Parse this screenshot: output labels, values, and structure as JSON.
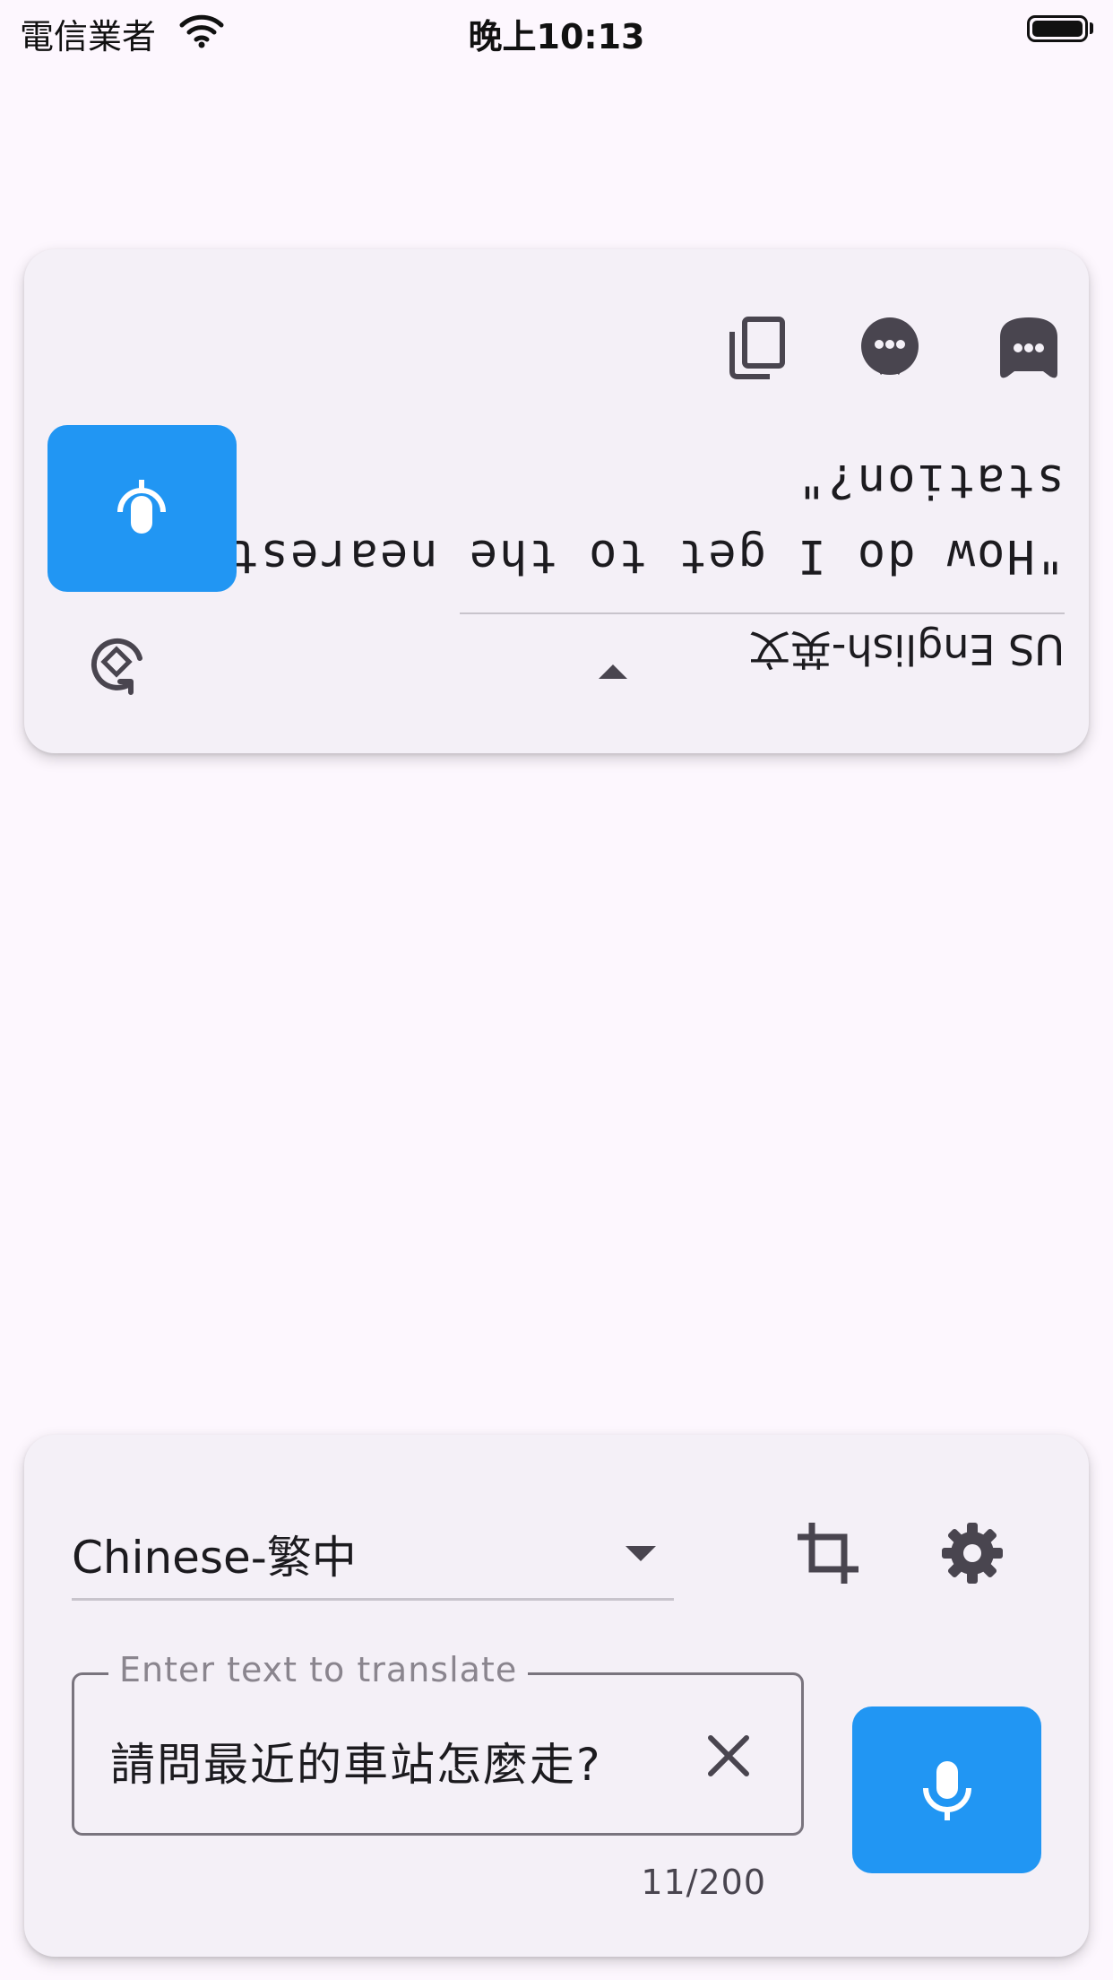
{
  "status_bar": {
    "carrier": "電信業者",
    "time": "晚上10:13"
  },
  "top_panel": {
    "target_language": "US English-英文",
    "translated_text": "\"How do I get to the nearest station?\"",
    "icons": {
      "rotate": "rotate-icon",
      "speaker": "speaker-icon",
      "copy": "copy-icon",
      "face_round": "face-round-icon",
      "face_rounded_square": "face-rounded-square-icon"
    }
  },
  "bottom_panel": {
    "source_language": "Chinese-繁中",
    "input": {
      "label": "Enter text to translate",
      "value": "請問最近的車站怎麼走?",
      "char_count": "11/200"
    },
    "icons": {
      "crop": "crop-icon",
      "settings": "gear-icon",
      "clear": "close-icon",
      "mic": "microphone-icon"
    }
  },
  "colors": {
    "accent": "#2196f3",
    "background": "#fdf7fe",
    "card": "#f4f0f7",
    "icon": "#49454f"
  }
}
